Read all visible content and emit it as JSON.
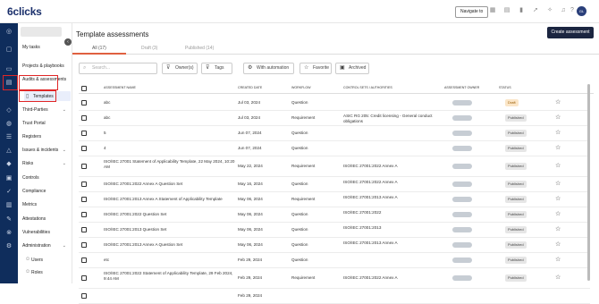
{
  "app": {
    "logo": "6clicks"
  },
  "topbar": {
    "navigate_label": "Navigate to",
    "icons": [
      "grid-icon",
      "calendar-icon",
      "bar-chart-icon",
      "rocket-icon",
      "bulb-icon",
      "bell-icon",
      "help-icon"
    ],
    "avatar_initials": "GL"
  },
  "rail": {
    "icons": [
      "home-icon",
      "dashboard-icon",
      "briefcase-icon",
      "audit-icon",
      "shield-icon",
      "globe-icon",
      "register-icon",
      "alert-icon",
      "risk-icon",
      "controls-icon",
      "compliance-icon",
      "metrics-icon",
      "attestation-icon",
      "vulnerability-icon",
      "admin-icon"
    ]
  },
  "sidebar": {
    "items": [
      {
        "label": "My tasks"
      },
      {
        "label": "Projects & playbooks"
      },
      {
        "label": "Audits & assessments"
      },
      {
        "label": "Templates"
      },
      {
        "label": "Third-Parties"
      },
      {
        "label": "Trust Portal"
      },
      {
        "label": "Registers"
      },
      {
        "label": "Issues & incidents"
      },
      {
        "label": "Risks"
      },
      {
        "label": "Controls"
      },
      {
        "label": "Compliance"
      },
      {
        "label": "Metrics"
      },
      {
        "label": "Attestations"
      },
      {
        "label": "Vulnerabilities"
      },
      {
        "label": "Administration"
      },
      {
        "label": "Users"
      },
      {
        "label": "Roles"
      }
    ]
  },
  "main": {
    "title": "Template assessments",
    "create_label": "Create assessment",
    "tabs": [
      {
        "label": "All (17)"
      },
      {
        "label": "Draft (3)"
      },
      {
        "label": "Published (14)"
      }
    ],
    "search_placeholder": "Search...",
    "filters": {
      "owners": "Owner(s)",
      "tags": "Tags",
      "automation": "With automation",
      "favorite": "Favorite",
      "archived": "Archived"
    },
    "columns": {
      "name": "Assessment Name",
      "created": "Created Date",
      "workflow": "Workflow",
      "control_sets": "Control Sets / Authorities",
      "owner": "Assessment Owner",
      "status": "Status"
    },
    "rows": [
      {
        "name": "abc",
        "created": "Jul 03, 2024",
        "workflow": "Question",
        "control_set": "",
        "status": "Draft"
      },
      {
        "name": "abc",
        "created": "Jul 03, 2024",
        "workflow": "Requirement",
        "control_set": "ASIC RG 205: Credit licensing - General conduct obligations",
        "status": "Published"
      },
      {
        "name": "5",
        "created": "Jun 07, 2024",
        "workflow": "Question",
        "control_set": "",
        "status": "Published"
      },
      {
        "name": "4",
        "created": "Jun 07, 2024",
        "workflow": "Question",
        "control_set": "",
        "status": "Published"
      },
      {
        "name": "ISO/IEC 27001 Statement of Applicability Template, 22 May 2024, 10:20 AM",
        "created": "May 22, 2024",
        "workflow": "Requirement",
        "control_set": "ISO/IEC 27001:2022 Annex A",
        "status": "Published"
      },
      {
        "name": "ISO/IEC 27001:2022 Annex A Question Set",
        "created": "May 16, 2024",
        "workflow": "Question",
        "control_set": "ISO/IEC 27001:2022 Annex A",
        "status": "Published"
      },
      {
        "name": "ISO/IEC 27001:2013 Annex A Statement of Applicability Template",
        "created": "May 06, 2024",
        "workflow": "Requirement",
        "control_set": "ISO/IEC 27001:2013 Annex A",
        "status": "Published"
      },
      {
        "name": "ISO/IEC 27001:2022 Question Set",
        "created": "May 06, 2024",
        "workflow": "Question",
        "control_set": "ISO/IEC 27001:2022",
        "status": "Published"
      },
      {
        "name": "ISO/IEC 27001:2013 Question Set",
        "created": "May 06, 2024",
        "workflow": "Question",
        "control_set": "ISO/IEC 27001:2013",
        "status": "Published"
      },
      {
        "name": "ISO/IEC 27001:2013 Annex A Question Set",
        "created": "May 06, 2024",
        "workflow": "Question",
        "control_set": "ISO/IEC 27001:2013 Annex A",
        "status": "Published"
      },
      {
        "name": "etc",
        "created": "Feb 29, 2024",
        "workflow": "Question",
        "control_set": "",
        "status": "Published"
      },
      {
        "name": "ISO/IEC 27001:2022 Statement of Applicability Template, 29 Feb 2024, 9:44 AM",
        "created": "Feb 29, 2024",
        "workflow": "Requirement",
        "control_set": "ISO/IEC 27001:2022 Annex A",
        "status": "Published"
      },
      {
        "name": "",
        "created": "Feb 29, 2024",
        "workflow": "",
        "control_set": "",
        "status": ""
      }
    ]
  },
  "colors": {
    "rail": "#0f2d5c",
    "accent": "#e06040",
    "highlight": "#e02626",
    "create_button": "#1b2540"
  }
}
